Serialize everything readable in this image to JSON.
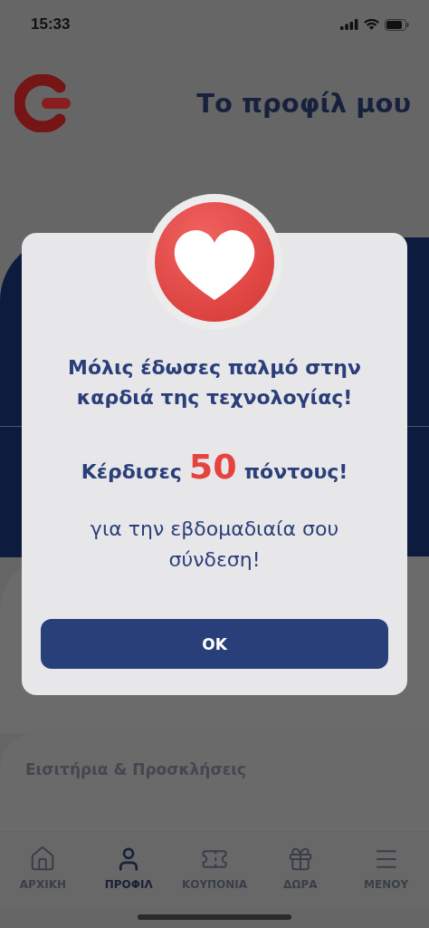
{
  "status_bar": {
    "time": "15:33"
  },
  "header": {
    "title": "Το προφίλ μου"
  },
  "sections": [
    {
      "title": "Εισιτήρια & Προσκλήσεις"
    }
  ],
  "tab_bar": [
    {
      "kind": "home",
      "label": "ΑΡΧΙΚΗ",
      "selected": false
    },
    {
      "kind": "profile",
      "label": "ΠΡΟΦΙΛ",
      "selected": true
    },
    {
      "kind": "coupons",
      "label": "ΚΟΥΠΟΝΙΑ",
      "selected": false
    },
    {
      "kind": "gifts",
      "label": "ΔΩΡΑ",
      "selected": false
    },
    {
      "kind": "menu",
      "label": "ΜΕΝΟΥ",
      "selected": false
    }
  ],
  "dialog": {
    "title": "Μόλις έδωσες παλμό στην καρδιά της τεχνολογίας!",
    "reward": {
      "before": "Κέρδισες",
      "points": "50",
      "after": "πόντους!"
    },
    "message": "για την εβδομαδιαία σου σύνδεση!",
    "button": "OK"
  }
}
